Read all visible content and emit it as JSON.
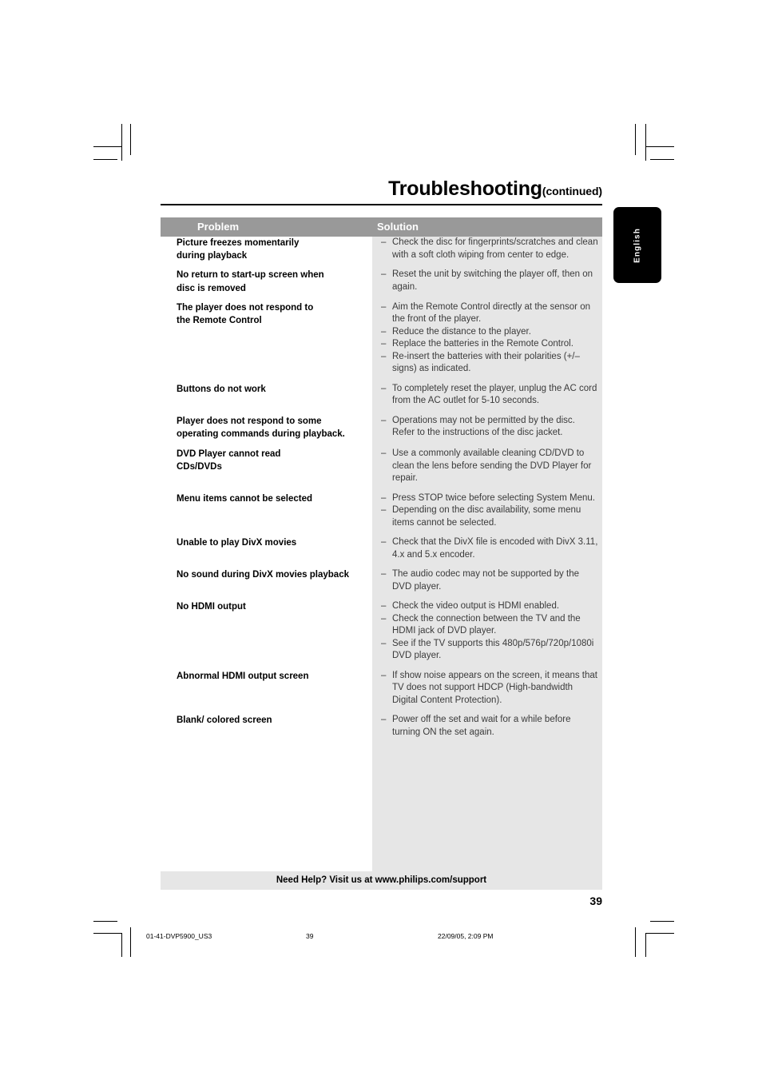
{
  "header": {
    "title": "Troubleshooting",
    "title_suffix": "(continued)",
    "language_tab": "English"
  },
  "table": {
    "columns": [
      "Problem",
      "Solution"
    ],
    "rows": [
      {
        "problem": [
          "Picture freezes momentarily",
          "during playback"
        ],
        "solutions": [
          "Check the disc for fingerprints/scratches and clean with a soft cloth wiping from center to edge."
        ]
      },
      {
        "problem": [
          "No return to start-up screen when",
          "disc is removed"
        ],
        "solutions": [
          "Reset the unit by switching the player off, then on again."
        ]
      },
      {
        "problem": [
          "The player does not respond to",
          "the Remote Control"
        ],
        "solutions": [
          "Aim the Remote Control directly at the sensor on the front of the player.",
          "Reduce the distance to the player.",
          "Replace the batteries in the Remote Control.",
          "Re-insert the batteries with their polarities (+/– signs) as indicated."
        ]
      },
      {
        "problem": [
          "Buttons do not work"
        ],
        "solutions": [
          "To completely reset the player, unplug the AC cord from the AC outlet for 5-10 seconds."
        ]
      },
      {
        "problem": [
          "Player does not respond to some",
          "operating commands during playback."
        ],
        "solutions": [
          "Operations may not be permitted by the disc. Refer to the instructions of  the disc jacket."
        ]
      },
      {
        "problem": [
          "DVD Player cannot read",
          "CDs/DVDs"
        ],
        "solutions": [
          "Use a commonly available cleaning CD/DVD to clean the lens before sending the DVD Player for repair."
        ]
      },
      {
        "problem": [
          "Menu items cannot be selected"
        ],
        "solutions": [
          "Press STOP twice before selecting System Menu.",
          "Depending on the disc availability, some menu items cannot be selected."
        ]
      },
      {
        "problem": [
          "Unable to play DivX movies"
        ],
        "solutions": [
          "Check that the DivX file is encoded with DivX 3.11, 4.x and 5.x encoder."
        ]
      },
      {
        "problem": [
          "No sound during DivX movies playback"
        ],
        "solutions": [
          "The audio codec may not be supported by the DVD player."
        ]
      },
      {
        "problem": [
          "No HDMI output"
        ],
        "solutions": [
          "Check the video output is HDMI enabled.",
          "Check the connection between the TV and the HDMI jack of DVD player.",
          "See if the TV supports this 480p/576p/720p/1080i DVD player."
        ]
      },
      {
        "problem": [
          "Abnormal HDMI output screen"
        ],
        "solutions": [
          "If show noise appears on the screen, it means that TV does not support HDCP (High-bandwidth Digital Content Protection)."
        ]
      },
      {
        "problem": [
          "Blank/ colored screen"
        ],
        "solutions": [
          "Power off the set and wait for a while before turning ON the set again."
        ]
      }
    ]
  },
  "footer": {
    "help_text": "Need Help?  Visit us at www.philips.com/support",
    "page_number": "39"
  },
  "print_slug": {
    "file": "01-41-DVP5900_US3",
    "page": "39",
    "date": "22/09/05, 2:09 PM"
  }
}
